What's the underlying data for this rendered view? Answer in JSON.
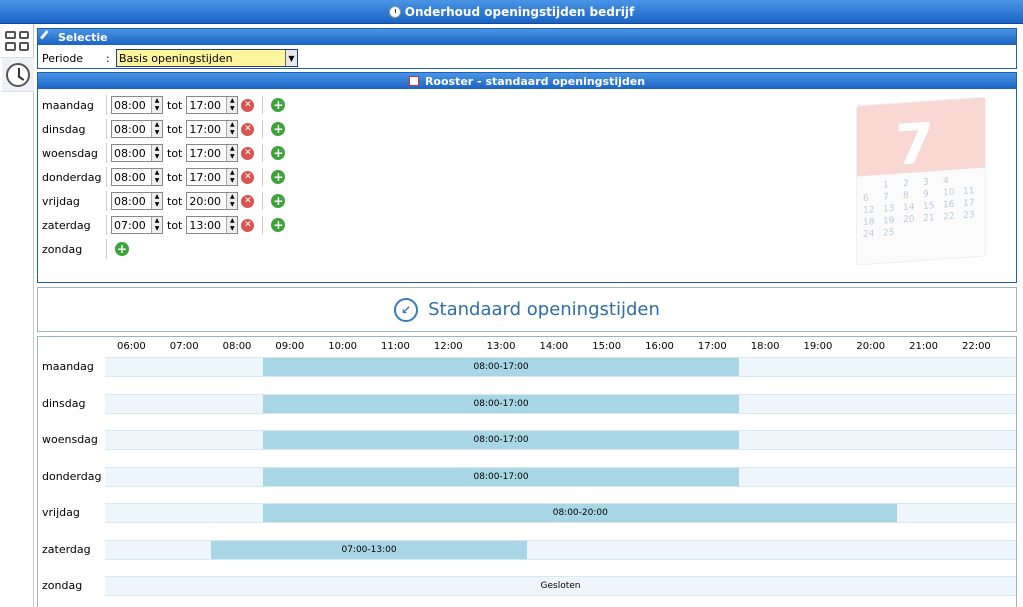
{
  "window": {
    "title": "Onderhoud openingstijden bedrijf"
  },
  "sidebar": {
    "items": [
      {
        "icon": "grid-icon"
      },
      {
        "icon": "clock-icon"
      }
    ]
  },
  "selectie": {
    "title": "Selectie",
    "periode_label": "Periode",
    "colon": ":",
    "periode_value": "Basis openingstijden"
  },
  "rooster": {
    "title": "Rooster - standaard openingstijden",
    "tot_label": "tot",
    "days": [
      {
        "day": "maandag",
        "from": "08:00",
        "to": "17:00"
      },
      {
        "day": "dinsdag",
        "from": "08:00",
        "to": "17:00"
      },
      {
        "day": "woensdag",
        "from": "08:00",
        "to": "17:00"
      },
      {
        "day": "donderdag",
        "from": "08:00",
        "to": "17:00"
      },
      {
        "day": "vrijdag",
        "from": "08:00",
        "to": "20:00"
      },
      {
        "day": "zaterdag",
        "from": "07:00",
        "to": "13:00"
      }
    ],
    "closed_day": "zondag",
    "calendar_art": {
      "big_number": "7",
      "numbers": [
        "",
        "1",
        "2",
        "3",
        "4",
        "",
        "6",
        "7",
        "8",
        "9",
        "10",
        "11",
        "12",
        "13",
        "14",
        "15",
        "16",
        "17",
        "18",
        "19",
        "20",
        "21",
        "22",
        "23",
        "24",
        "25"
      ]
    }
  },
  "banner": {
    "title": "Standaard openingstijden"
  },
  "schedule": {
    "hours": [
      "06:00",
      "07:00",
      "08:00",
      "09:00",
      "10:00",
      "11:00",
      "12:00",
      "13:00",
      "14:00",
      "15:00",
      "16:00",
      "17:00",
      "18:00",
      "19:00",
      "20:00",
      "21:00",
      "22:00"
    ],
    "rows": [
      {
        "day": "maandag",
        "start": 8.5,
        "end": 17.5,
        "label": "08:00-17:00"
      },
      {
        "day": "dinsdag",
        "start": 8.5,
        "end": 17.5,
        "label": "08:00-17:00"
      },
      {
        "day": "woensdag",
        "start": 8.5,
        "end": 17.5,
        "label": "08:00-17:00"
      },
      {
        "day": "donderdag",
        "start": 8.5,
        "end": 17.5,
        "label": "08:00-17:00"
      },
      {
        "day": "vrijdag",
        "start": 8.5,
        "end": 20.5,
        "label": "08:00-20:00"
      },
      {
        "day": "zaterdag",
        "start": 7.5,
        "end": 13.5,
        "label": "07:00-13:00"
      },
      {
        "day": "zondag",
        "closed": true,
        "label": "Gesloten"
      }
    ]
  },
  "colors": {
    "header_blue": "#1a63c4",
    "bar": "#a9d6e5",
    "track": "#eef6fb",
    "select_bg": "#fff59d"
  }
}
